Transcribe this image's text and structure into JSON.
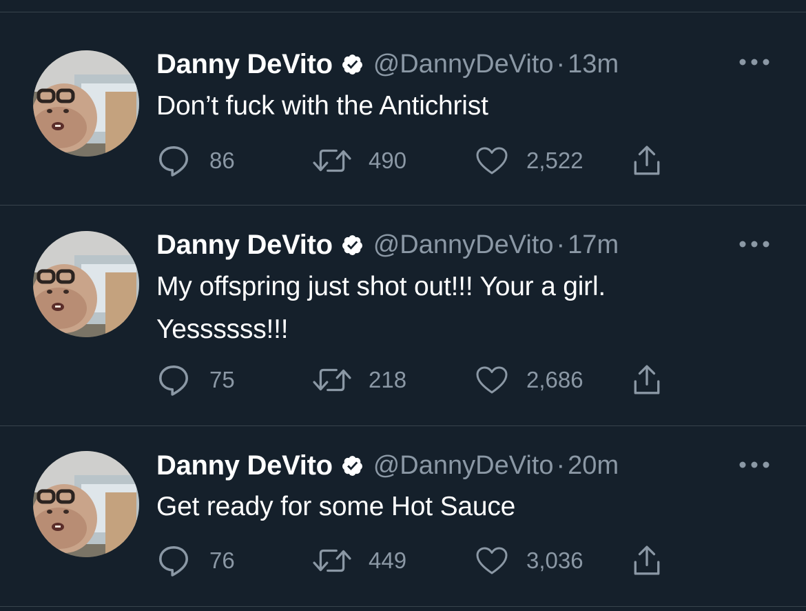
{
  "colors": {
    "background": "#15202b",
    "text_primary": "#ffffff",
    "text_secondary": "#8b98a5",
    "divider": "#38444d",
    "verified_badge": "#ffffff"
  },
  "icons": {
    "reply": "speech-bubble-icon",
    "retweet": "retweet-icon",
    "like": "heart-icon",
    "share": "share-icon",
    "more": "more-dots-icon",
    "verified": "verified-badge-icon"
  },
  "tweets": [
    {
      "name": "Danny DeVito",
      "handle": "@DannyDeVito",
      "separator": "·",
      "time": "13m",
      "text_lines": [
        "Don’t fuck with the Antichrist"
      ],
      "replies": "86",
      "retweets": "490",
      "likes": "2,522"
    },
    {
      "name": "Danny DeVito",
      "handle": "@DannyDeVito",
      "separator": "·",
      "time": "17m",
      "text_lines": [
        "My offspring just shot out!!! Your a girl.",
        "Yessssss!!!"
      ],
      "replies": "75",
      "retweets": "218",
      "likes": "2,686"
    },
    {
      "name": "Danny DeVito",
      "handle": "@DannyDeVito",
      "separator": "·",
      "time": "20m",
      "text_lines": [
        "Get ready for some Hot Sauce"
      ],
      "replies": "76",
      "retweets": "449",
      "likes": "3,036"
    }
  ]
}
